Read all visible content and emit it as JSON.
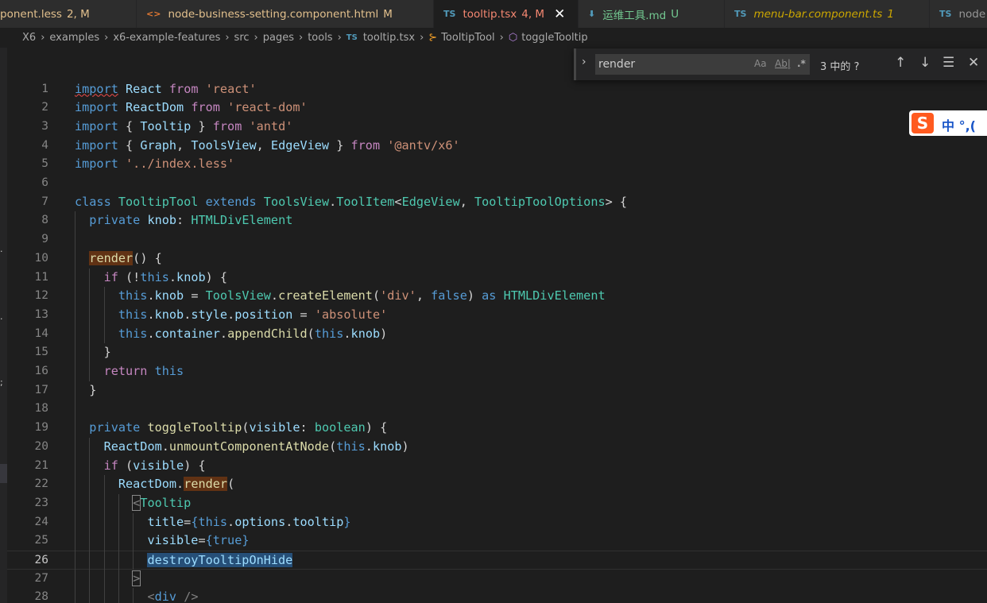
{
  "tabs": [
    {
      "icon": "",
      "name": "ponent.less",
      "status": "2, M",
      "name_color": "#e2c08d",
      "status_color": "#e2c08d",
      "icon_color": "#519aba",
      "active": false,
      "close": ""
    },
    {
      "icon": "<>",
      "name": "node-business-setting.component.html",
      "status": "M",
      "name_color": "#e2c08d",
      "status_color": "#e2c08d",
      "icon_color": "#e37933",
      "active": false,
      "close": ""
    },
    {
      "icon": "TS",
      "name": "tooltip.tsx",
      "status": "4, M",
      "name_color": "#f48771",
      "status_color": "#f48771",
      "icon_color": "#519aba",
      "active": true,
      "close": "✕"
    },
    {
      "icon": "⬇",
      "name": "运维工具.md",
      "status": "U",
      "name_color": "#73c991",
      "status_color": "#73c991",
      "icon_color": "#519aba",
      "active": false,
      "close": ""
    },
    {
      "icon": "TS",
      "name": "menu-bar.component.ts",
      "status": "1",
      "name_color": "#cca700",
      "status_color": "#cca700",
      "icon_color": "#519aba",
      "active": false,
      "close": "",
      "italic": true
    },
    {
      "icon": "TS",
      "name": "node",
      "status": "",
      "name_color": "#969696",
      "status_color": "#969696",
      "icon_color": "#519aba",
      "active": false,
      "close": ""
    }
  ],
  "breadcrumb": {
    "items": [
      "X6",
      "examples",
      "x6-example-features",
      "src",
      "pages",
      "tools"
    ],
    "file_icon": "TS",
    "file": "tooltip.tsx",
    "class_icon": "class-icon",
    "class_name": "TooltipTool",
    "method_icon": "method-icon",
    "method_name": "toggleTooltip"
  },
  "find": {
    "toggle_icon": "chevron-right-icon",
    "value": "render",
    "match_case": "Aa",
    "whole_word": "Ab|",
    "regex": ".*",
    "result": "3 中的 ?",
    "prev_icon": "arrow-up-icon",
    "next_icon": "arrow-down-icon",
    "selection_icon": "find-in-selection-icon",
    "close_icon": "close-icon"
  },
  "ime": {
    "logo": "S",
    "text": "中 °,("
  },
  "editor": {
    "current_line": 26,
    "lines": [
      {
        "n": 1,
        "tokens": [
          [
            "kw",
            "import"
          ],
          [
            "pl",
            " "
          ],
          [
            "var",
            "React"
          ],
          [
            "pl",
            " "
          ],
          [
            "ck",
            "from"
          ],
          [
            "pl",
            " "
          ],
          [
            "str",
            "'react'"
          ]
        ]
      },
      {
        "n": 2,
        "tokens": [
          [
            "kw",
            "import"
          ],
          [
            "pl",
            " "
          ],
          [
            "var",
            "ReactDom"
          ],
          [
            "pl",
            " "
          ],
          [
            "ck",
            "from"
          ],
          [
            "pl",
            " "
          ],
          [
            "str",
            "'react-dom'"
          ]
        ]
      },
      {
        "n": 3,
        "tokens": [
          [
            "kw",
            "import"
          ],
          [
            "pl",
            " { "
          ],
          [
            "var",
            "Tooltip"
          ],
          [
            "pl",
            " } "
          ],
          [
            "ck",
            "from"
          ],
          [
            "pl",
            " "
          ],
          [
            "str",
            "'antd'"
          ]
        ]
      },
      {
        "n": 4,
        "tokens": [
          [
            "kw",
            "import"
          ],
          [
            "pl",
            " { "
          ],
          [
            "var",
            "Graph"
          ],
          [
            "pl",
            ", "
          ],
          [
            "var",
            "ToolsView"
          ],
          [
            "pl",
            ", "
          ],
          [
            "var",
            "EdgeView"
          ],
          [
            "pl",
            " } "
          ],
          [
            "ck",
            "from"
          ],
          [
            "pl",
            " "
          ],
          [
            "str",
            "'@antv/x6'"
          ]
        ]
      },
      {
        "n": 5,
        "tokens": [
          [
            "kw",
            "import"
          ],
          [
            "pl",
            " "
          ],
          [
            "str",
            "'../index.less'"
          ]
        ]
      },
      {
        "n": 6,
        "tokens": []
      },
      {
        "n": 7,
        "tokens": [
          [
            "kw",
            "class"
          ],
          [
            "pl",
            " "
          ],
          [
            "ty",
            "TooltipTool"
          ],
          [
            "pl",
            " "
          ],
          [
            "kw",
            "extends"
          ],
          [
            "pl",
            " "
          ],
          [
            "ty",
            "ToolsView"
          ],
          [
            "pl",
            "."
          ],
          [
            "ty",
            "ToolItem"
          ],
          [
            "pl",
            "<"
          ],
          [
            "ty",
            "EdgeView"
          ],
          [
            "pl",
            ", "
          ],
          [
            "ty",
            "TooltipToolOptions"
          ],
          [
            "pl",
            "> {"
          ]
        ]
      },
      {
        "n": 8,
        "tokens": [
          [
            "pl",
            "  "
          ],
          [
            "kw",
            "private"
          ],
          [
            "pl",
            " "
          ],
          [
            "var",
            "knob"
          ],
          [
            "pl",
            ": "
          ],
          [
            "ty",
            "HTMLDivElement"
          ]
        ]
      },
      {
        "n": 9,
        "tokens": []
      },
      {
        "n": 10,
        "tokens": [
          [
            "pl",
            "  "
          ],
          [
            "fn",
            "render"
          ],
          [
            "pl",
            "() {"
          ]
        ]
      },
      {
        "n": 11,
        "tokens": [
          [
            "pl",
            "    "
          ],
          [
            "ck",
            "if"
          ],
          [
            "pl",
            " (!"
          ],
          [
            "kw",
            "this"
          ],
          [
            "pl",
            "."
          ],
          [
            "var",
            "knob"
          ],
          [
            "pl",
            ") {"
          ]
        ]
      },
      {
        "n": 12,
        "tokens": [
          [
            "pl",
            "      "
          ],
          [
            "kw",
            "this"
          ],
          [
            "pl",
            "."
          ],
          [
            "var",
            "knob"
          ],
          [
            "pl",
            " = "
          ],
          [
            "ty",
            "ToolsView"
          ],
          [
            "pl",
            "."
          ],
          [
            "fn",
            "createElement"
          ],
          [
            "pl",
            "("
          ],
          [
            "str",
            "'div'"
          ],
          [
            "pl",
            ", "
          ],
          [
            "kw",
            "false"
          ],
          [
            "pl",
            ") "
          ],
          [
            "kw",
            "as"
          ],
          [
            "pl",
            " "
          ],
          [
            "ty",
            "HTMLDivElement"
          ]
        ]
      },
      {
        "n": 13,
        "tokens": [
          [
            "pl",
            "      "
          ],
          [
            "kw",
            "this"
          ],
          [
            "pl",
            "."
          ],
          [
            "var",
            "knob"
          ],
          [
            "pl",
            "."
          ],
          [
            "var",
            "style"
          ],
          [
            "pl",
            "."
          ],
          [
            "var",
            "position"
          ],
          [
            "pl",
            " = "
          ],
          [
            "str",
            "'absolute'"
          ]
        ]
      },
      {
        "n": 14,
        "tokens": [
          [
            "pl",
            "      "
          ],
          [
            "kw",
            "this"
          ],
          [
            "pl",
            "."
          ],
          [
            "var",
            "container"
          ],
          [
            "pl",
            "."
          ],
          [
            "fn",
            "appendChild"
          ],
          [
            "pl",
            "("
          ],
          [
            "kw",
            "this"
          ],
          [
            "pl",
            "."
          ],
          [
            "var",
            "knob"
          ],
          [
            "pl",
            ")"
          ]
        ]
      },
      {
        "n": 15,
        "tokens": [
          [
            "pl",
            "    }"
          ]
        ]
      },
      {
        "n": 16,
        "tokens": [
          [
            "pl",
            "    "
          ],
          [
            "ck",
            "return"
          ],
          [
            "pl",
            " "
          ],
          [
            "kw",
            "this"
          ]
        ]
      },
      {
        "n": 17,
        "tokens": [
          [
            "pl",
            "  }"
          ]
        ]
      },
      {
        "n": 18,
        "tokens": []
      },
      {
        "n": 19,
        "tokens": [
          [
            "pl",
            "  "
          ],
          [
            "kw",
            "private"
          ],
          [
            "pl",
            " "
          ],
          [
            "fn",
            "toggleTooltip"
          ],
          [
            "pl",
            "("
          ],
          [
            "var",
            "visible"
          ],
          [
            "pl",
            ": "
          ],
          [
            "ty",
            "boolean"
          ],
          [
            "pl",
            ") {"
          ]
        ]
      },
      {
        "n": 20,
        "tokens": [
          [
            "pl",
            "    "
          ],
          [
            "var",
            "ReactDom"
          ],
          [
            "pl",
            "."
          ],
          [
            "fn",
            "unmountComponentAtNode"
          ],
          [
            "pl",
            "("
          ],
          [
            "kw",
            "this"
          ],
          [
            "pl",
            "."
          ],
          [
            "var",
            "knob"
          ],
          [
            "pl",
            ")"
          ]
        ]
      },
      {
        "n": 21,
        "tokens": [
          [
            "pl",
            "    "
          ],
          [
            "ck",
            "if"
          ],
          [
            "pl",
            " ("
          ],
          [
            "var",
            "visible"
          ],
          [
            "pl",
            ") {"
          ]
        ]
      },
      {
        "n": 22,
        "tokens": [
          [
            "pl",
            "      "
          ],
          [
            "var",
            "ReactDom"
          ],
          [
            "pl",
            "."
          ],
          [
            "fn",
            "render"
          ],
          [
            "pl",
            "("
          ]
        ]
      },
      {
        "n": 23,
        "tokens": [
          [
            "pl",
            "        "
          ],
          [
            "ang",
            "<"
          ],
          [
            "tag",
            "Tooltip"
          ]
        ]
      },
      {
        "n": 24,
        "tokens": [
          [
            "pl",
            "          "
          ],
          [
            "var",
            "title"
          ],
          [
            "pl",
            "="
          ],
          [
            "kw",
            "{"
          ],
          [
            "kw",
            "this"
          ],
          [
            "pl",
            "."
          ],
          [
            "var",
            "options"
          ],
          [
            "pl",
            "."
          ],
          [
            "var",
            "tooltip"
          ],
          [
            "kw",
            "}"
          ]
        ]
      },
      {
        "n": 25,
        "tokens": [
          [
            "pl",
            "          "
          ],
          [
            "var",
            "visible"
          ],
          [
            "pl",
            "="
          ],
          [
            "kw",
            "{"
          ],
          [
            "kw",
            "true"
          ],
          [
            "kw",
            "}"
          ]
        ]
      },
      {
        "n": 26,
        "tokens": [
          [
            "pl",
            "          "
          ],
          [
            "var",
            "destroyTooltipOnHide"
          ]
        ]
      },
      {
        "n": 27,
        "tokens": [
          [
            "pl",
            "        "
          ],
          [
            "ang",
            ">"
          ]
        ]
      },
      {
        "n": 28,
        "tokens": [
          [
            "pl",
            "          "
          ],
          [
            "ang",
            "<"
          ],
          [
            "kw",
            "div"
          ],
          [
            "pl",
            " "
          ],
          [
            "ang",
            "/>"
          ]
        ]
      }
    ]
  }
}
